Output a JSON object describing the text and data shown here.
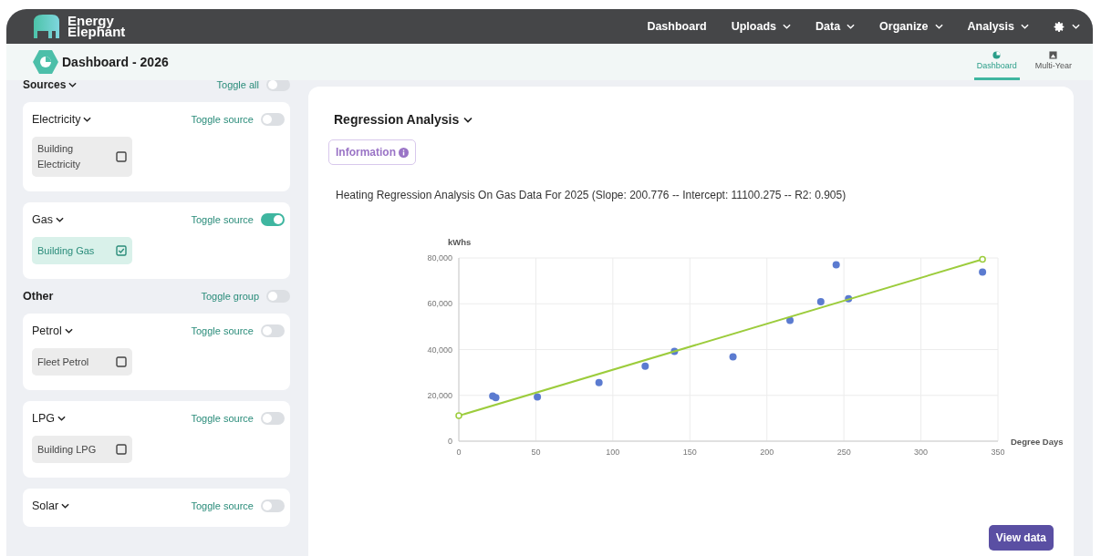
{
  "brand": {
    "line_1": "Energy",
    "line_2": "Elephant"
  },
  "nav": [
    {
      "label": "Dashboard",
      "dropdown": false
    },
    {
      "label": "Uploads",
      "dropdown": true
    },
    {
      "label": "Data",
      "dropdown": true
    },
    {
      "label": "Organize",
      "dropdown": true
    },
    {
      "label": "Analysis",
      "dropdown": true
    }
  ],
  "page_title": "Dashboard - 2026",
  "view_tabs": [
    {
      "label": "Dashboard",
      "selected": true
    },
    {
      "label": "Multi-Year",
      "selected": false
    }
  ],
  "groups": [
    {
      "title": "Sources",
      "dropdown": true,
      "toggle_label": "Toggle all",
      "on": false,
      "sources": [
        {
          "name": "Electricity",
          "toggle_label": "Toggle source",
          "on": false,
          "items": [
            {
              "label": "Building Electricity",
              "checked": false
            }
          ]
        },
        {
          "name": "Gas",
          "toggle_label": "Toggle source",
          "on": true,
          "items": [
            {
              "label": "Building Gas",
              "checked": true
            }
          ]
        }
      ]
    },
    {
      "title": "Other",
      "dropdown": false,
      "toggle_label": "Toggle group",
      "on": false,
      "sources": [
        {
          "name": "Petrol",
          "toggle_label": "Toggle source",
          "on": false,
          "items": [
            {
              "label": "Fleet Petrol",
              "checked": false
            }
          ]
        },
        {
          "name": "LPG",
          "toggle_label": "Toggle source",
          "on": false,
          "items": [
            {
              "label": "Building LPG",
              "checked": false
            }
          ]
        },
        {
          "name": "Solar",
          "toggle_label": "Toggle source",
          "on": false
        }
      ]
    }
  ],
  "analysis": {
    "title": "Regression Analysis",
    "info_button": "Information",
    "summary": "Heating Regression Analysis On Gas Data For 2025 (Slope: 200.776 -- Intercept: 11100.275 -- R2: 0.905)",
    "chart_data": {
      "type": "scatter",
      "xlabel": "Degree Days",
      "ylabel": "kWhs",
      "x": [
        0,
        22,
        24,
        51,
        91,
        121,
        140,
        178,
        215,
        235,
        245,
        253,
        340
      ],
      "series": [
        {
          "type": "scatter",
          "color": "#5b7bd0",
          "values": [
            null,
            19700,
            19000,
            19300,
            25600,
            32700,
            39200,
            36800,
            52700,
            60900,
            77000,
            62200,
            73800
          ]
        },
        {
          "type": "line",
          "color": "#9ccc3c",
          "marker": "hollow_circle",
          "values": [
            11100,
            null,
            null,
            null,
            null,
            null,
            null,
            null,
            null,
            null,
            null,
            null,
            79400
          ]
        }
      ],
      "grid": true,
      "xlim": [
        0,
        350
      ],
      "ylim": [
        0,
        80000
      ],
      "xticks": [
        0,
        50,
        100,
        150,
        200,
        250,
        300,
        350
      ],
      "yticks": [
        {
          "value": 0,
          "label": "0"
        },
        {
          "value": 20000,
          "label": "20,000"
        },
        {
          "value": 40000,
          "label": "40,000"
        },
        {
          "value": 60000,
          "label": "60,000"
        },
        {
          "value": 80000,
          "label": "80,000"
        }
      ],
      "stacked": false
    },
    "view_button": "View data"
  }
}
